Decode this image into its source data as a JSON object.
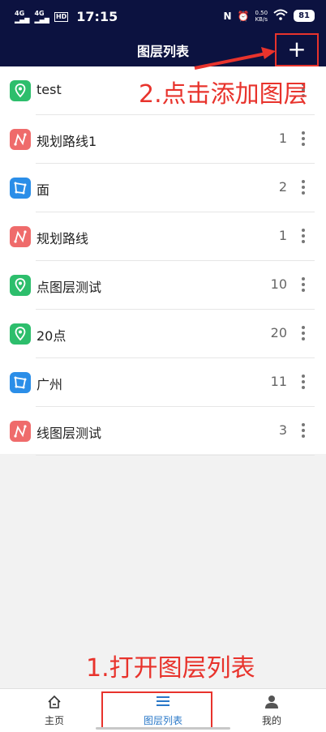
{
  "status_bar": {
    "signal1": "4G",
    "signal2": "4G",
    "hd": "HD",
    "time": "17:15",
    "nfc": "N",
    "speed_value": "0.50",
    "speed_unit": "KB/s",
    "battery": "81"
  },
  "header": {
    "title": "图层列表",
    "add_label": "+"
  },
  "annotations": {
    "step2": "2.点击添加图层",
    "step1": "1.打开图层列表",
    "color": "#e8332c"
  },
  "layers": [
    {
      "name": "test",
      "count": "",
      "type": "point",
      "color": "#2dbe6c"
    },
    {
      "name": "规划路线1",
      "count": "1",
      "type": "line",
      "color": "#ef6b6b"
    },
    {
      "name": "面",
      "count": "2",
      "type": "polygon",
      "color": "#2b8ee8"
    },
    {
      "name": "规划路线",
      "count": "1",
      "type": "line",
      "color": "#ef6b6b"
    },
    {
      "name": "点图层测试",
      "count": "10",
      "type": "point",
      "color": "#2dbe6c"
    },
    {
      "name": "20点",
      "count": "20",
      "type": "point",
      "color": "#2dbe6c"
    },
    {
      "name": "广州",
      "count": "11",
      "type": "polygon",
      "color": "#2b8ee8"
    },
    {
      "name": "线图层测试",
      "count": "3",
      "type": "line",
      "color": "#ef6b6b"
    }
  ],
  "tabs": [
    {
      "label": "主页",
      "icon": "home-icon"
    },
    {
      "label": "图层列表",
      "icon": "list-icon"
    },
    {
      "label": "我的",
      "icon": "person-icon"
    }
  ],
  "colors": {
    "header_bg": "#0c1240",
    "active_tab": "#2a78c8"
  }
}
